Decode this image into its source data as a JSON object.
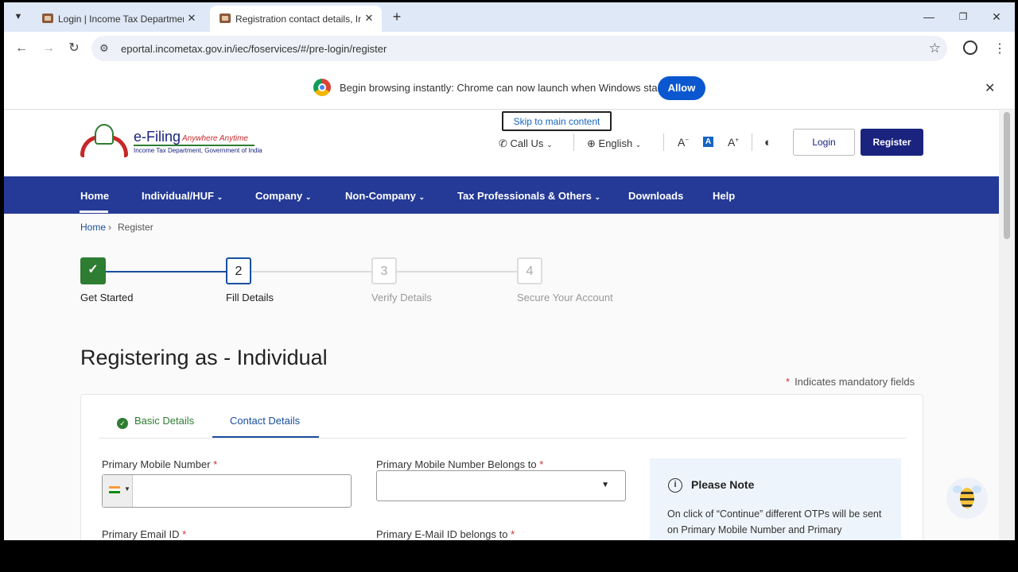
{
  "tabs": [
    {
      "title": "Login | Income Tax Department",
      "active": false
    },
    {
      "title": "Registration contact details, Inc",
      "active": true
    }
  ],
  "address_bar": {
    "url": "eportal.incometax.gov.in/iec/foservices/#/pre-login/register"
  },
  "infobar": {
    "message": "Begin browsing instantly: Chrome can now launch when Windows starts.",
    "allow_label": "Allow"
  },
  "site": {
    "logo_title": "e-Filing",
    "logo_tagline": "Anywhere Anytime",
    "logo_subtitle": "Income Tax Department, Government of India",
    "skip_link": "Skip to main content",
    "call_us": "Call Us",
    "language": "English",
    "font_decrease": "A",
    "font_normal": "A",
    "font_increase": "A",
    "login": "Login",
    "register": "Register"
  },
  "nav": {
    "items": [
      "Home",
      "Individual/HUF",
      "Company",
      "Non-Company",
      "Tax Professionals & Others",
      "Downloads",
      "Help"
    ]
  },
  "breadcrumb": {
    "home": "Home",
    "separator": "›",
    "current": "Register"
  },
  "stepper": {
    "steps": [
      {
        "number": "✓",
        "label": "Get Started",
        "state": "completed"
      },
      {
        "number": "2",
        "label": "Fill Details",
        "state": "current"
      },
      {
        "number": "3",
        "label": "Verify Details",
        "state": "pending"
      },
      {
        "number": "4",
        "label": "Secure Your Account",
        "state": "pending"
      }
    ]
  },
  "form": {
    "heading": "Registering as -  Individual",
    "mandatory_note": "Indicates mandatory fields",
    "tabs": {
      "basic": "Basic Details",
      "contact": "Contact Details"
    },
    "primary_mobile_label": "Primary Mobile Number",
    "primary_mobile_value": "",
    "mobile_belongs_label": "Primary Mobile Number Belongs to",
    "mobile_belongs_value": "",
    "primary_email_label": "Primary Email ID",
    "email_belongs_label": "Primary E-Mail ID belongs to",
    "asterisk": "*"
  },
  "note": {
    "title": "Please Note",
    "text": "On click of “Continue” different OTPs will be sent on Primary Mobile Number and Primary"
  },
  "colors": {
    "brand_navy": "#1a237e",
    "nav_blue": "#243a96",
    "success_green": "#2e7d32",
    "link_blue": "#1565c0"
  }
}
